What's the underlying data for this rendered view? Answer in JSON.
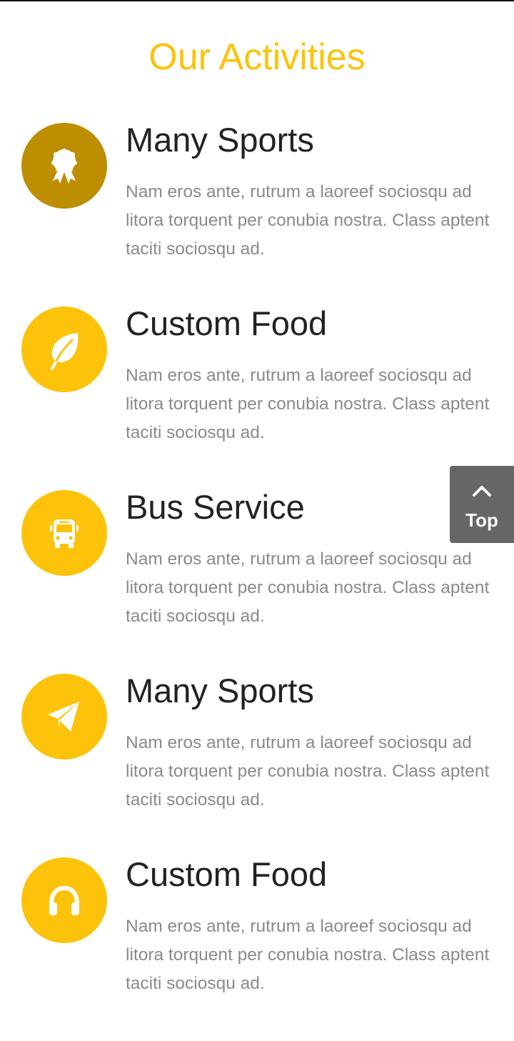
{
  "header": {
    "title": "Our Activities"
  },
  "colors": {
    "accent": "#FDC30A",
    "accent_dark": "#BC8E00",
    "heading": "#222222",
    "body_text": "#8A8A8A",
    "top_button_bg": "#666666"
  },
  "activities": [
    {
      "title": "Many Sports",
      "description": "Nam eros ante, rutrum a laoreef sociosqu ad litora torquent per conubia nostra. Class aptent taciti sociosqu ad.",
      "icon": "award-ribbon-icon",
      "circle_color": "#BC8E00"
    },
    {
      "title": "Custom Food",
      "description": "Nam eros ante, rutrum a laoreef sociosqu ad litora torquent per conubia nostra. Class aptent taciti sociosqu ad.",
      "icon": "leaf-icon",
      "circle_color": "#FDC30A"
    },
    {
      "title": "Bus Service",
      "description": "Nam eros ante, rutrum a laoreef sociosqu ad litora torquent per conubia nostra. Class aptent taciti sociosqu ad.",
      "icon": "bus-icon",
      "circle_color": "#FDC30A"
    },
    {
      "title": "Many Sports",
      "description": "Nam eros ante, rutrum a laoreef sociosqu ad litora torquent per conubia nostra. Class aptent taciti sociosqu ad.",
      "icon": "paper-plane-icon",
      "circle_color": "#FDC30A"
    },
    {
      "title": "Custom Food",
      "description": "Nam eros ante, rutrum a laoreef sociosqu ad litora torquent per conubia nostra. Class aptent taciti sociosqu ad.",
      "icon": "headphones-icon",
      "circle_color": "#FDC30A"
    }
  ],
  "back_to_top": {
    "label": "Top",
    "icon": "chevron-up-icon"
  }
}
